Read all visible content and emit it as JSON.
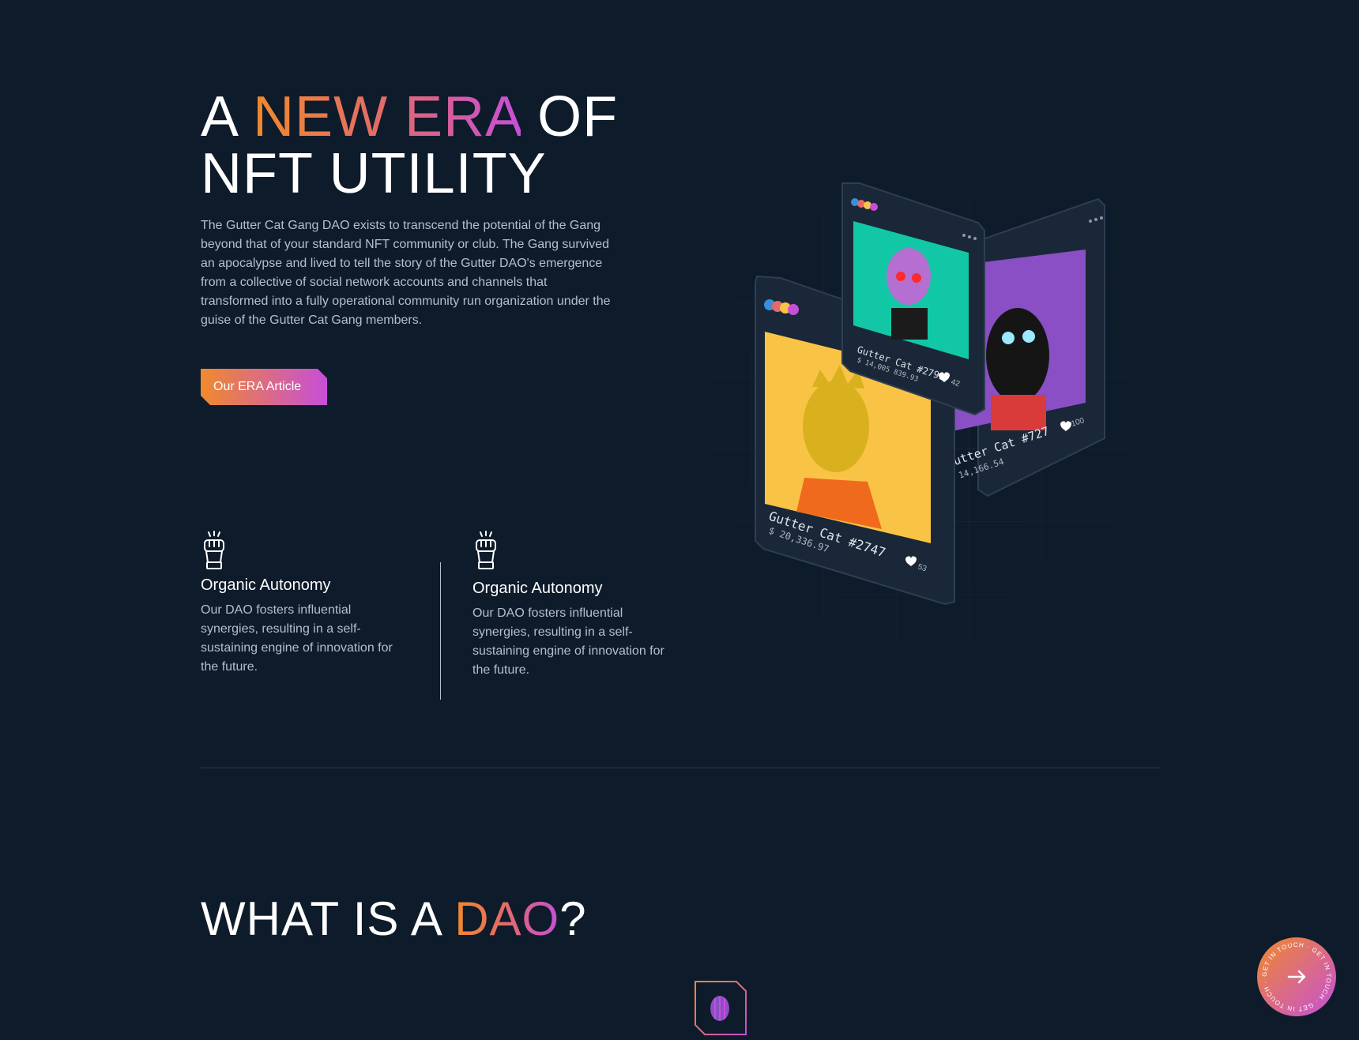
{
  "hero": {
    "title_line1_prefix": "A ",
    "title_highlight": "NEW ERA",
    "title_line1_suffix": " OF",
    "title_line2": "NFT UTILITY",
    "description": "The Gutter Cat Gang DAO exists to transcend the potential of the Gang beyond that of your standard NFT community or club. The Gang survived an apocalypse and lived to tell the story of the Gutter DAO's emergence from a collective of social network accounts and channels that transformed into a fully operational community run organization under the guise of the Gutter Cat Gang members.",
    "cta_label": "Our ERA Article"
  },
  "features": [
    {
      "icon": "raised-fist-icon",
      "title": "Organic Autonomy",
      "text": "Our DAO fosters influential synergies, resulting in a self-sustaining engine of innovation for the future."
    },
    {
      "icon": "raised-fist-icon",
      "title": "Organic Autonomy",
      "text": "Our DAO fosters influential synergies, resulting in a self-sustaining engine of innovation for the future."
    }
  ],
  "nft_cards": [
    {
      "name": "Gutter Cat #2747",
      "price": "$ 20,336.97",
      "likes": "53",
      "bg": "#f9c446"
    },
    {
      "name": "Gutter Cat #2791",
      "price": "$ 14,005 839.93",
      "likes": "42",
      "bg": "#11c7a6"
    },
    {
      "name": "Gutter Cat #727",
      "price": "$ 14,166.54",
      "likes": "100",
      "bg": "#8a4fc4"
    }
  ],
  "dao_section": {
    "title_prefix": "WHAT IS A ",
    "title_highlight": "DAO",
    "title_suffix": "?"
  },
  "get_in_touch": {
    "ring_text": "GET IN TOUCH · GET IN TOUCH · GET IN TOUCH ·",
    "icon": "arrow-right-icon"
  },
  "colors": {
    "background": "#0e1b2b",
    "accent_orange": "#f08a2c",
    "accent_purple": "#c64fd8",
    "card": "#1a2738"
  }
}
